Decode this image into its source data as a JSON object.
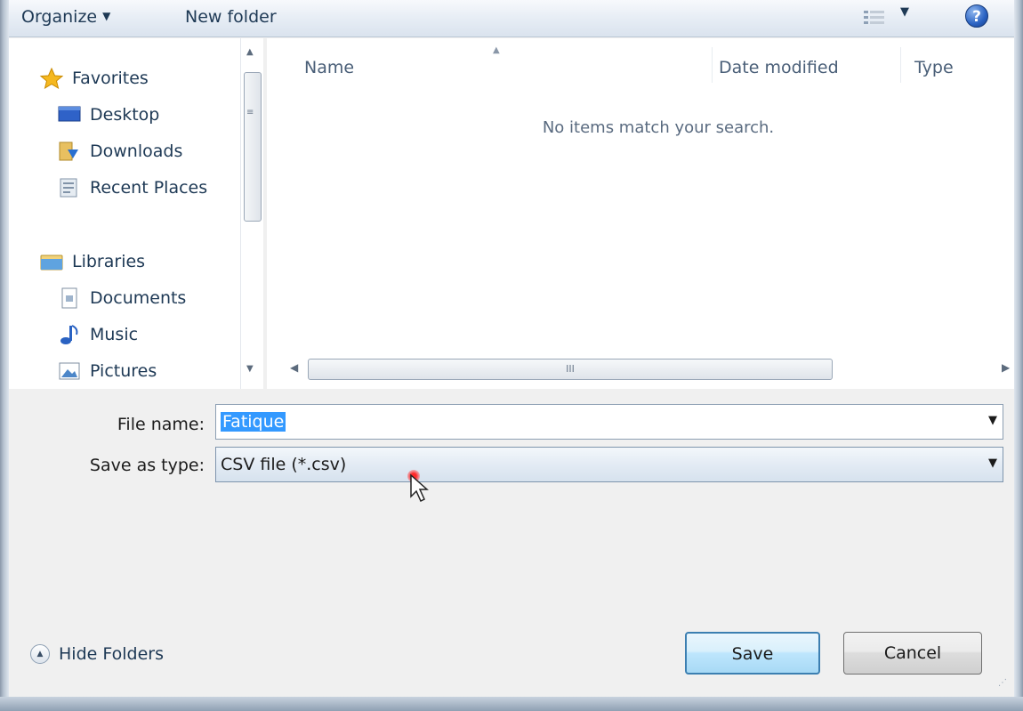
{
  "toolbar": {
    "organize_label": "Organize",
    "new_folder_label": "New folder",
    "view_icon": "views-icon",
    "help_icon": "help-icon",
    "help_glyph": "?"
  },
  "navigation": {
    "favorites": {
      "label": "Favorites",
      "items": [
        {
          "label": "Desktop",
          "icon": "desktop-icon"
        },
        {
          "label": "Downloads",
          "icon": "downloads-icon"
        },
        {
          "label": "Recent Places",
          "icon": "recent-places-icon"
        }
      ]
    },
    "libraries": {
      "label": "Libraries",
      "items": [
        {
          "label": "Documents",
          "icon": "documents-icon"
        },
        {
          "label": "Music",
          "icon": "music-icon"
        },
        {
          "label": "Pictures",
          "icon": "pictures-icon"
        }
      ]
    }
  },
  "file_list": {
    "columns": [
      "Name",
      "Date modified",
      "Type"
    ],
    "empty_message": "No items match your search.",
    "hscroll_grip": "III"
  },
  "form": {
    "file_name_label": "File name:",
    "file_name_value": "Fatique",
    "save_type_label": "Save as type:",
    "save_type_value": "CSV file (*.csv)"
  },
  "footer": {
    "hide_folders_label": "Hide Folders",
    "save_label": "Save",
    "cancel_label": "Cancel"
  },
  "colors": {
    "selection": "#3399ff",
    "save_button_border": "#3c7fb1",
    "toolbar_text": "#1e3955"
  }
}
